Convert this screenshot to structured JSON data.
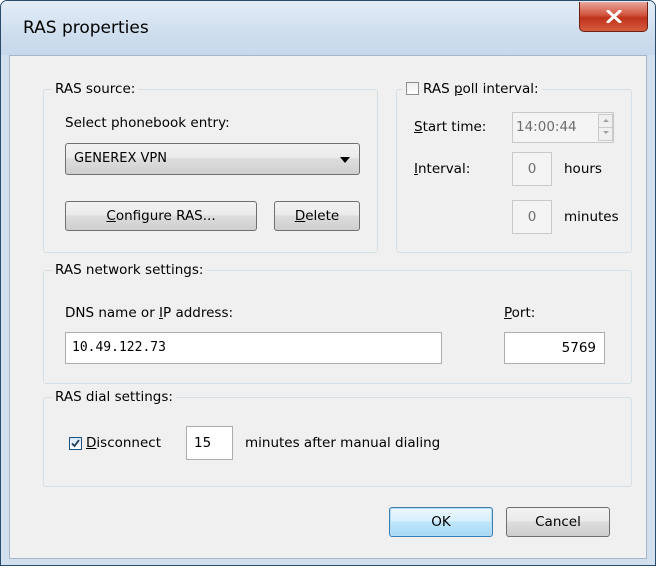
{
  "window": {
    "title": "RAS properties",
    "close_icon": "close-icon"
  },
  "ras_source": {
    "title": "RAS source:",
    "phonebook_label": "Select phonebook entry:",
    "phonebook_selected": "GENEREX VPN",
    "configure_label_u": "C",
    "configure_label_rest": "onfigure RAS...",
    "delete_label_u": "D",
    "delete_label_rest": "elete"
  },
  "poll": {
    "checkbox_checked": false,
    "title_pre": "RAS ",
    "title_u": "p",
    "title_post": "oll interval:",
    "start_time_label_u": "S",
    "start_time_label_rest": "tart time:",
    "start_time_value": "14:00:44",
    "interval_label_u": "I",
    "interval_label_rest": "nterval:",
    "hours_value": "0",
    "hours_unit": "hours",
    "minutes_value": "0",
    "minutes_unit": "minutes"
  },
  "network": {
    "title": "RAS network settings:",
    "dns_label_pre": "DNS name or ",
    "dns_label_u": "I",
    "dns_label_post": "P address:",
    "dns_value": "10.49.122.73",
    "port_label_u": "P",
    "port_label_rest": "ort:",
    "port_value": "5769"
  },
  "dial": {
    "title": "RAS dial settings:",
    "disconnect_checked": true,
    "disconnect_label_u": "D",
    "disconnect_label_rest": "isconnect",
    "minutes_value": "15",
    "suffix": "minutes after manual dialing"
  },
  "buttons": {
    "ok": "OK",
    "cancel": "Cancel"
  },
  "colors": {
    "title_bg": "#cfdeee",
    "close_red": "#c0321b",
    "dialog_bg": "#f0f0f0",
    "focus_blue": "#3c7fb1"
  }
}
